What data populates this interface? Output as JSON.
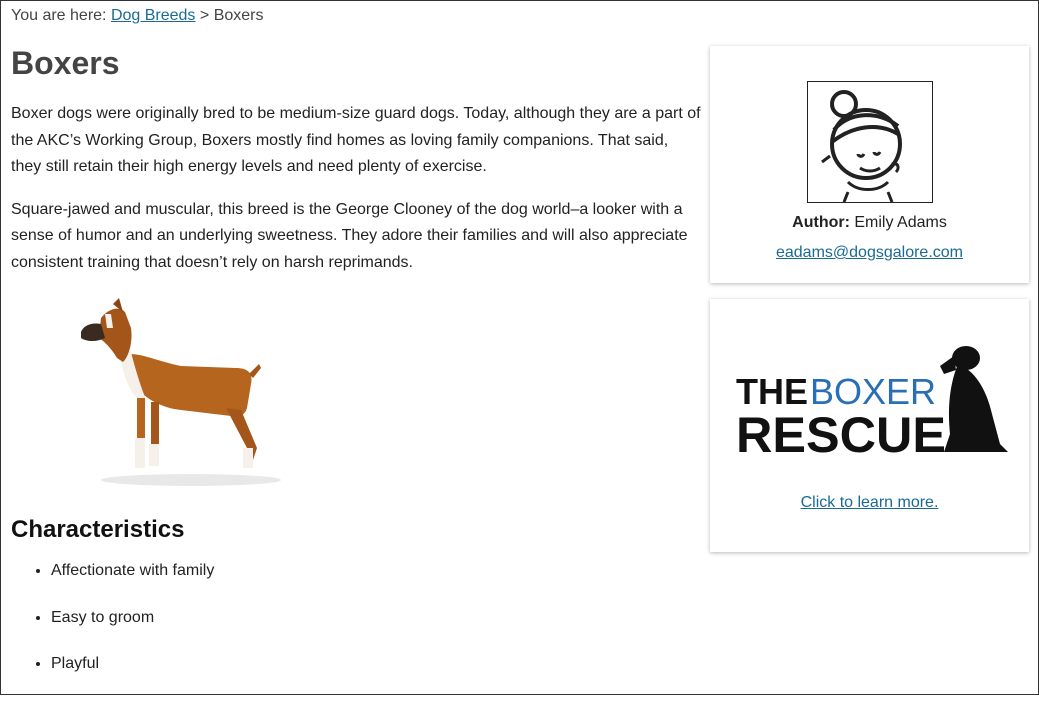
{
  "breadcrumb": {
    "prefix": "You are here:",
    "link": "Dog Breeds",
    "separator": ">",
    "current": "Boxers"
  },
  "article": {
    "title": "Boxers",
    "paragraphs": [
      "Boxer dogs were originally bred to be medium-size guard dogs. Today, although they are a part of the AKC’s Working Group, Boxers mostly find homes as loving family companions. That said, they still retain their high energy levels and need plenty of exercise.",
      "Square-jawed and muscular, this breed is the George Clooney of the dog world–a looker with a sense of humor and an underlying sweetness. They adore their families and will also appreciate consistent training that doesn’t rely on harsh reprimands."
    ],
    "image_icon": "boxer-dog-photo",
    "characteristics_heading": "Characteristics",
    "characteristics": [
      "Affectionate with family",
      "Easy to groom",
      "Playful"
    ]
  },
  "author_card": {
    "avatar_icon": "woman-avatar-drawing",
    "author_label": "Author:",
    "author_name": "Emily Adams",
    "email": "eadams@dogsgalore.com"
  },
  "rescue_card": {
    "logo_line1_a": "THE",
    "logo_line1_b": "BOXER",
    "logo_line2": "RESCUE",
    "link": "Click to learn more."
  },
  "colors": {
    "link": "#1a6a94",
    "logo_blue": "#2a6fb5",
    "heading": "#444444"
  }
}
